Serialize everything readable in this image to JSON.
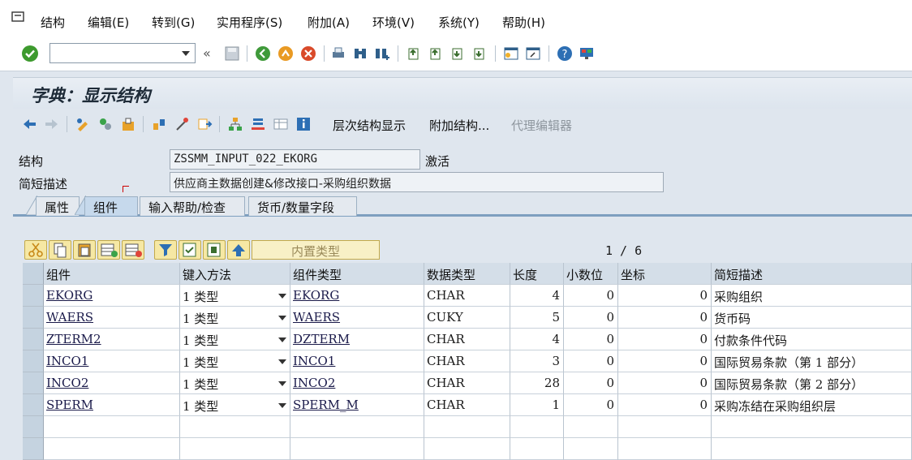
{
  "menu": [
    "结构",
    "编辑(E)",
    "转到(G)",
    "实用程序(S)",
    "附加(A)",
    "环境(V)",
    "系统(Y)",
    "帮助(H)"
  ],
  "title": "字典：显示结构",
  "app_toolbar": {
    "hierarchy": "层次结构显示",
    "append": "附加结构...",
    "proxy_editor": "代理编辑器"
  },
  "header": {
    "structure_label": "结构",
    "structure_value": "ZSSMM_INPUT_022_EKORG",
    "status": "激活",
    "desc_label": "简短描述",
    "desc_value": "供应商主数据创建&修改接口-采购组织数据"
  },
  "tabs": [
    "属性",
    "组件",
    "输入帮助/检查",
    "货币/数量字段"
  ],
  "table": {
    "builtin_type_button": "内置类型",
    "pager": "1 / 6",
    "columns": [
      "组件",
      "键入方法",
      "组件类型",
      "数据类型",
      "长度",
      "小数位",
      "坐标",
      "简短描述"
    ],
    "rows": [
      [
        "EKORG",
        "1 类型",
        "EKORG",
        "CHAR",
        "4",
        "0",
        "0",
        "采购组织"
      ],
      [
        "WAERS",
        "1 类型",
        "WAERS",
        "CUKY",
        "5",
        "0",
        "0",
        "货币码"
      ],
      [
        "ZTERM2",
        "1 类型",
        "DZTERM",
        "CHAR",
        "4",
        "0",
        "0",
        "付款条件代码"
      ],
      [
        "INCO1",
        "1 类型",
        "INCO1",
        "CHAR",
        "3",
        "0",
        "0",
        "国际贸易条款（第 1 部分）"
      ],
      [
        "INCO2",
        "1 类型",
        "INCO2",
        "CHAR",
        "28",
        "0",
        "0",
        "国际贸易条款（第 2 部分）"
      ],
      [
        "SPERM",
        "1 类型",
        "SPERM_M",
        "CHAR",
        "1",
        "0",
        "0",
        "采购冻结在采购组织层"
      ]
    ]
  },
  "colors": {
    "accent": "#7e9fbf",
    "header_bg": "#d4dee8",
    "panel_bg": "#dfe6ee"
  }
}
